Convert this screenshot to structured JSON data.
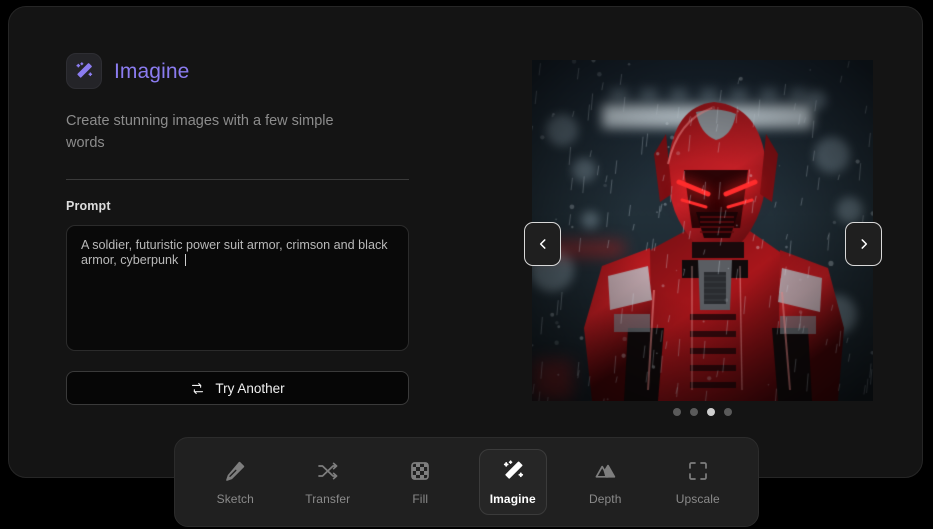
{
  "app": {
    "title": "Imagine",
    "logo_icon": "magic-wand-icon",
    "subtitle": "Create stunning images with a few simple words",
    "accent_color": "#8b7cf0",
    "card_background": "#141414"
  },
  "prompt": {
    "label": "Prompt",
    "value": "A soldier, futuristic power suit armor, crimson and black armor, cyberpunk ",
    "placeholder": "Describe what you want to see..."
  },
  "actions": {
    "try_another_label": "Try Another",
    "try_another_icon": "repeat-icon"
  },
  "preview": {
    "prev_icon": "chevron-left-icon",
    "next_icon": "chevron-right-icon",
    "alt": "Crimson and black futuristic power suit armor soldier, cyberpunk",
    "dots": [
      {
        "active": false
      },
      {
        "active": false
      },
      {
        "active": true
      },
      {
        "active": false
      }
    ]
  },
  "toolbar": {
    "items": [
      {
        "label": "Sketch",
        "icon": "pencil-icon",
        "active": false
      },
      {
        "label": "Transfer",
        "icon": "shuffle-icon",
        "active": false
      },
      {
        "label": "Fill",
        "icon": "checkerboard-icon",
        "active": false
      },
      {
        "label": "Imagine",
        "icon": "magic-wand-icon",
        "active": true
      },
      {
        "label": "Depth",
        "icon": "mountain-icon",
        "active": false
      },
      {
        "label": "Upscale",
        "icon": "expand-icon",
        "active": false
      }
    ]
  }
}
